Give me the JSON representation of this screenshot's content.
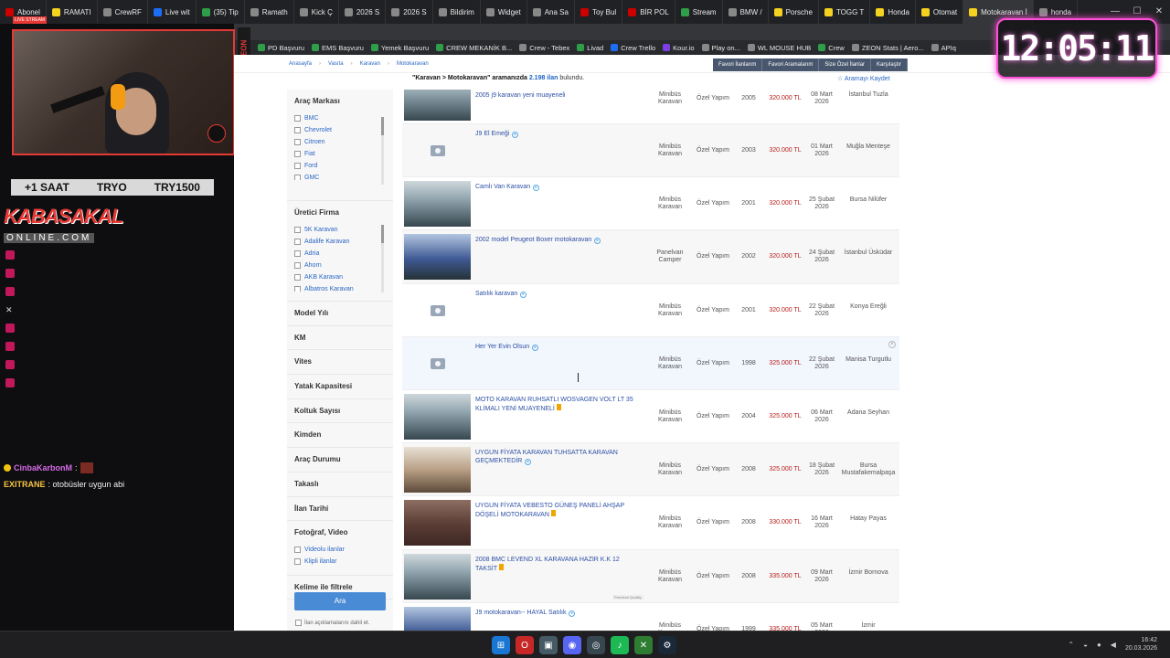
{
  "browser": {
    "tabs": [
      {
        "label": "Abonel",
        "icon": "red"
      },
      {
        "label": "RAMATI",
        "icon": "yellow"
      },
      {
        "label": "CrewRF",
        "icon": "grey"
      },
      {
        "label": "Live wit",
        "icon": "blue"
      },
      {
        "label": "(35) Tip",
        "icon": "green"
      },
      {
        "label": "Ramath",
        "icon": "grey"
      },
      {
        "label": "Kick Ç",
        "icon": "grey"
      },
      {
        "label": "2026 S",
        "icon": "grey"
      },
      {
        "label": "2026 S",
        "icon": "grey"
      },
      {
        "label": "Bildirim",
        "icon": "grey"
      },
      {
        "label": "Widget",
        "icon": "grey"
      },
      {
        "label": "Ana Sa",
        "icon": "grey"
      },
      {
        "label": "Toy Bul",
        "icon": "red"
      },
      {
        "label": "BİR POL",
        "icon": "red"
      },
      {
        "label": "Stream",
        "icon": "green"
      },
      {
        "label": "BMW / ",
        "icon": "grey"
      },
      {
        "label": "Porsche",
        "icon": "yellow"
      },
      {
        "label": "TOGG T",
        "icon": "yellow"
      },
      {
        "label": "Honda",
        "icon": "yellow"
      },
      {
        "label": "Otomat",
        "icon": "yellow"
      },
      {
        "label": "Motokaravan İ",
        "icon": "yellow",
        "active": true
      },
      {
        "label": "honda",
        "icon": "grey"
      }
    ],
    "bookmarks": [
      {
        "label": "PD Başvuru",
        "icon": "green"
      },
      {
        "label": "EMS Başvuru",
        "icon": "green"
      },
      {
        "label": "Yemek Başvuru",
        "icon": "green"
      },
      {
        "label": "CREW MEKANİK B...",
        "icon": "green"
      },
      {
        "label": "Crew - Tebex",
        "icon": "grey"
      },
      {
        "label": "Livad",
        "icon": "green"
      },
      {
        "label": "Crew Trello",
        "icon": "blue"
      },
      {
        "label": "Kour.io",
        "icon": "purple"
      },
      {
        "label": "Play on...",
        "icon": "grey"
      },
      {
        "label": "WL MOUSE HUB",
        "icon": "grey"
      },
      {
        "label": "Crew",
        "icon": "green"
      },
      {
        "label": "ZEON Stats | Aero...",
        "icon": "grey"
      },
      {
        "label": "APIq",
        "icon": "grey"
      }
    ]
  },
  "stream": {
    "live_label": "LIVE STREAM",
    "hour_bar": [
      "+1 SAAT",
      "TRYO",
      "TRY1500"
    ],
    "brand_top": "KABASAKAL",
    "brand_bottom": "ONLINE.COM",
    "chat": [
      {
        "user": "CinbaKarbonM",
        "text": " :"
      },
      {
        "user": "EXITRANE",
        "text": " : otobüsler uygun abi"
      }
    ],
    "zeon_label": "ZEON"
  },
  "clock": "12:05:11",
  "page": {
    "breadcrumb": [
      "Anasayfa",
      "Vasıta",
      "Karavan",
      "Motokaravan"
    ],
    "fav_links": [
      "Favori İlanlarım",
      "Favori Aramalarım",
      "Size Özel İlanlar",
      "Karşılaştır"
    ],
    "search_info_prefix": "\"Karavan > Motokaravan\" aramanızda",
    "search_count": "2.198 ilan",
    "search_info_suffix": "bulundu.",
    "save_search": "Aramayı Kaydet",
    "filters": {
      "brand_title": "Araç Markası",
      "brands": [
        "BMC",
        "Chevrolet",
        "Citroen",
        "Fiat",
        "Ford",
        "GMC"
      ],
      "maker_title": "Üretici Firma",
      "makers": [
        "5K Karavan",
        "Adalife Karavan",
        "Adria",
        "Ahorn",
        "AKB Karavan",
        "Albatros Karavan"
      ],
      "sections": [
        "Model Yılı",
        "KM",
        "Vites",
        "Yatak Kapasitesi",
        "Koltuk Sayısı",
        "Kimden",
        "Araç Durumu",
        "Takaslı",
        "İlan Tarihi"
      ],
      "photo_title": "Fotoğraf, Video",
      "photo_opts": [
        "Videolu ilanlar",
        "Klipli ilanlar"
      ],
      "keyword_title": "Kelime ile filtrele",
      "search_button": "Ara",
      "search_option": "İlan açıklamalarını dahil et."
    },
    "listings": [
      {
        "title": "2005 j9 karavan yeni muayeneli",
        "type": "Minibüs Karavan",
        "model": "Özel Yapım",
        "year": "2005",
        "price": "320.000 TL",
        "date": "08 Mart 2026",
        "loc": "İstanbul Tuzla",
        "thumb": "photo"
      },
      {
        "title": "J9 El Emeği",
        "type": "Minibüs Karavan",
        "model": "Özel Yapım",
        "year": "2003",
        "price": "320.000 TL",
        "date": "01 Mart 2026",
        "loc": "Muğla Menteşe",
        "thumb": "empty"
      },
      {
        "title": "Camlı Van Karavan",
        "type": "Minibüs Karavan",
        "model": "Özel Yapım",
        "year": "2001",
        "price": "320.000 TL",
        "date": "25 Şubat 2026",
        "loc": "Bursa Nilüfer",
        "thumb": "photo"
      },
      {
        "title": "2002 model Peugeot Boxer motokaravan",
        "type": "Panelvan Camper",
        "model": "Özel Yapım",
        "year": "2002",
        "price": "320.000 TL",
        "date": "24 Şubat 2026",
        "loc": "İstanbul Üsküdar",
        "thumb": "photo3"
      },
      {
        "title": "Satılık karavan",
        "type": "Minibüs Karavan",
        "model": "Özel Yapım",
        "year": "2001",
        "price": "320.000 TL",
        "date": "22 Şubat 2026",
        "loc": "Konya Ereğli",
        "thumb": "empty"
      },
      {
        "title": "Her Yer Evin Olsun",
        "type": "Minibüs Karavan",
        "model": "Özel Yapım",
        "year": "1998",
        "price": "325.000 TL",
        "date": "22 Şubat 2026",
        "loc": "Manisa Turgutlu",
        "thumb": "empty"
      },
      {
        "title": "MOTO KARAVAN RUHSATLI WOSVAGEN VOLT LT 35 KLİMALI YENİ MUAYENELİ",
        "type": "Minibüs Karavan",
        "model": "Özel Yapım",
        "year": "2004",
        "price": "325.000 TL",
        "date": "06 Mart 2026",
        "loc": "Adana Seyhan",
        "thumb": "photo"
      },
      {
        "title": "UYGUN FİYATA KARAVAN TUHSATTA KARAVAN GEÇMEKTEDİR",
        "type": "Minibüs Karavan",
        "model": "Özel Yapım",
        "year": "2008",
        "price": "325.000 TL",
        "date": "18 Şubat 2026",
        "loc": "Bursa Mustafakemalpaşa",
        "thumb": "photo2"
      },
      {
        "title": "UYGUN FİYATA VEBESTO GÜNEŞ PANELİ AHŞAP DÖŞELİ MOTOKARAVAN",
        "type": "Minibüs Karavan",
        "model": "Özel Yapım",
        "year": "2008",
        "price": "330.000 TL",
        "date": "16 Mart 2026",
        "loc": "Hatay Payas",
        "thumb": "photo4"
      },
      {
        "title": "2008 BMC LEVEND XL KARAVANA HAZIR K.K 12 TAKSİT",
        "type": "Minibüs Karavan",
        "model": "Özel Yapım",
        "year": "2008",
        "price": "335.000 TL",
        "date": "09 Mart 2026",
        "loc": "İzmir Bornova",
        "thumb": "photo"
      },
      {
        "title": "J9 motokaravan-- HAYAL Satılık",
        "type": "Minibüs Karavan",
        "model": "Özel Yapım",
        "year": "1999",
        "price": "335.000 TL",
        "date": "05 Mart 2026",
        "loc": "İzmir",
        "thumb": "photo3"
      }
    ],
    "premium_label": "Premium Quality"
  },
  "taskbar": {
    "time": "16:42",
    "date": "20.03.2026"
  }
}
